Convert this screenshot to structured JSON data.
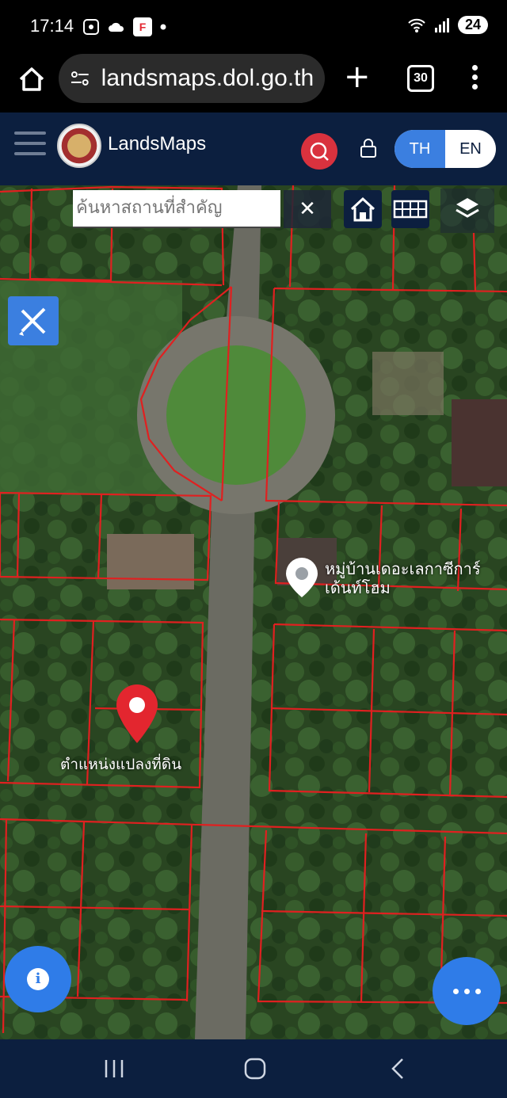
{
  "status_bar": {
    "time": "17:14",
    "battery": "24",
    "icons": [
      "screenshot-icon",
      "cloud-icon",
      "app-notification-icon",
      "dot-icon",
      "wifi-icon",
      "signal-icon"
    ]
  },
  "browser": {
    "url": "landsmaps.dol.go.th",
    "tab_count": "30",
    "icons": [
      "home-icon",
      "site-settings-icon",
      "plus-icon",
      "tabs-icon",
      "more-vert-icon"
    ]
  },
  "header": {
    "app_name": "LandsMaps",
    "lang_th": "TH",
    "lang_en": "EN",
    "active_lang": "TH",
    "colors": {
      "header_bg": "#0c1f3f",
      "search_red": "#d9323e",
      "accent_blue": "#3b7fe0"
    }
  },
  "map": {
    "search": {
      "placeholder": "ค้นหาสถานที่สำคัญ",
      "value": ""
    },
    "clear_label": "✕",
    "poi_label": "หมู่บ้านเดอะเลกาซีการ์เด้นท์โฮม",
    "parcel_label": "ตำแหน่งแปลงที่ดิน",
    "parcel_line_color": "#e02020",
    "marker_color": "#e3262f"
  },
  "nav": {
    "icons": [
      "recent-apps-icon",
      "home-nav-icon",
      "back-icon"
    ]
  }
}
